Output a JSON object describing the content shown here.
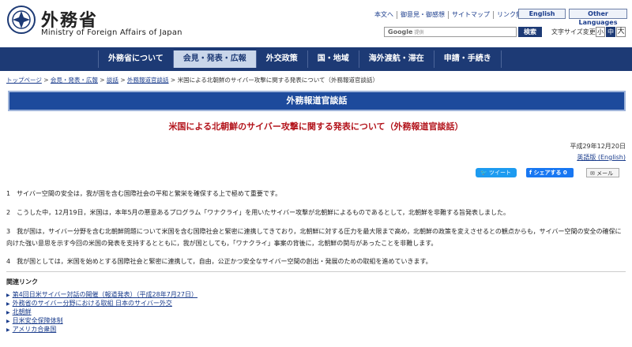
{
  "header": {
    "logo_ja": "外務省",
    "logo_en": "Ministry of Foreign Affairs of Japan",
    "util_links": [
      "本文へ",
      "御意見・御感想",
      "サイトマップ",
      "リンク集"
    ],
    "english": "English",
    "other_languages": "Other Languages",
    "search_google": "Google",
    "search_sub": "提供",
    "search_button": "検索",
    "font_size_label": "文字サイズ変更",
    "font_sizes": [
      "小",
      "中",
      "大"
    ]
  },
  "nav": [
    "外務省について",
    "会見・発表・広報",
    "外交政策",
    "国・地域",
    "海外渡航・滞在",
    "申請・手続き"
  ],
  "breadcrumb": [
    "トップページ",
    "会見・発表・広報",
    "談話",
    "外務報道官談話",
    "米国による北朝鮮のサイバー攻撃に関する発表について（外務報道官談話）"
  ],
  "banner": "外務報道官談話",
  "title": "米国による北朝鮮のサイバー攻撃に関する発表について（外務報道官談話）",
  "date": "平成29年12月20日",
  "english_version": "英語版 (English)",
  "social": {
    "tweet": "ツイート",
    "share": "シェアする 0",
    "mail": "メール"
  },
  "paragraphs": [
    "1　サイバー空間の安全は，我が国を含む国際社会の平和と繁栄を確保する上で極めて重要です。",
    "2　こうした中，12月19日，米国は，本年5月の悪意あるプログラム「ワナクライ」を用いたサイバー攻撃が北朝鮮によるものであるとして，北朝鮮を非難する旨発表しました。",
    "3　我が国は，サイバー分野を含む北朝鮮問題について米国を含む国際社会と緊密に連携してきており，北朝鮮に対する圧力を最大限まで高め，北朝鮮の政策を変えさせるとの観点からも，サイバー空間の安全の確保に向けた強い意思を示す今回の米国の発表を支持するとともに，我が国としても，「ワナクライ」事案の背後に，北朝鮮の関与があったことを非難します。",
    "4　我が国としては，米国を始めとする国際社会と緊密に連携して，自由，公正かつ安全なサイバー空間の創出・発展のための取組を進めていきます。"
  ],
  "related_title": "関連リンク",
  "related_links": [
    "第4回日米サイバー対話の開催（報道発表）（平成28年7月27日）",
    "外務省のサイバー分野における取組 日本のサイバー外交",
    "北朝鮮",
    "日米安全保障体制",
    "アメリカ合衆国"
  ]
}
